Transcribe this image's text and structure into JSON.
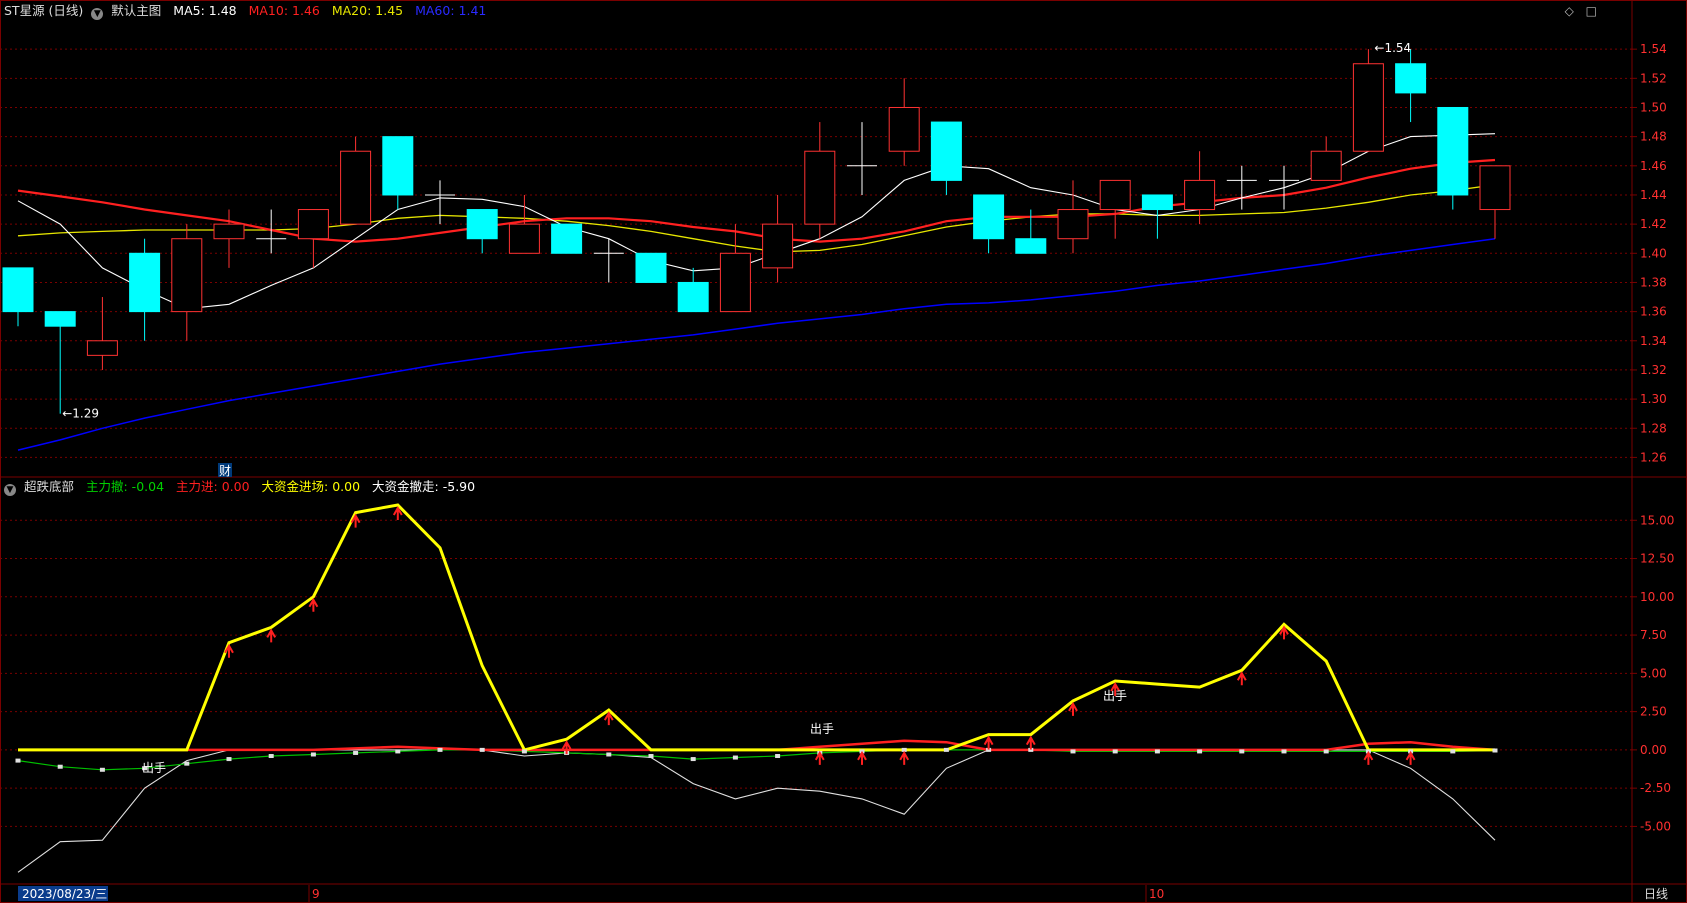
{
  "main_legend": {
    "title": "ST星源 (日线)",
    "template": "默认主图",
    "ma5": "MA5: 1.48",
    "ma10": "MA10: 1.46",
    "ma20": "MA20: 1.45",
    "ma60": "MA60: 1.41"
  },
  "sub_legend": {
    "title": "超跌底部",
    "zlc": "主力撤: -0.04",
    "zlj": "主力进: 0.00",
    "dzjjc": "大资金进场: 0.00",
    "dzjcz": "大资金撤走: -5.90"
  },
  "icons": {
    "diamond": "◇",
    "square": "□"
  },
  "annotations": {
    "low": "←1.29",
    "high": "←1.54",
    "cai": "财",
    "chushou": "出手"
  },
  "xaxis": {
    "date": "2023/08/23/三",
    "m9": "9",
    "m10": "10",
    "period": "日线"
  },
  "colors": {
    "up": "#ff3232",
    "down": "#00ffff",
    "ma5": "#ffffff",
    "ma10": "#ff2020",
    "ma20": "#e6e600",
    "ma60": "#0000ff",
    "yellow_line": "#ffff00",
    "green_line": "#00c000",
    "grid": "#7a0000"
  },
  "chart_data": [
    {
      "type": "candlestick",
      "title": "ST星源 (日线)",
      "ylim": [
        1.25,
        1.56
      ],
      "yticks": [
        1.26,
        1.28,
        1.3,
        1.32,
        1.34,
        1.36,
        1.38,
        1.4,
        1.42,
        1.44,
        1.46,
        1.48,
        1.5,
        1.52,
        1.54
      ],
      "candles": [
        {
          "o": 1.39,
          "h": 1.39,
          "l": 1.35,
          "c": 1.36
        },
        {
          "o": 1.36,
          "h": 1.36,
          "l": 1.29,
          "c": 1.35
        },
        {
          "o": 1.33,
          "h": 1.37,
          "l": 1.32,
          "c": 1.34
        },
        {
          "o": 1.4,
          "h": 1.41,
          "l": 1.34,
          "c": 1.36
        },
        {
          "o": 1.36,
          "h": 1.42,
          "l": 1.34,
          "c": 1.41
        },
        {
          "o": 1.41,
          "h": 1.43,
          "l": 1.39,
          "c": 1.42
        },
        {
          "o": 1.41,
          "h": 1.43,
          "l": 1.4,
          "c": 1.41
        },
        {
          "o": 1.41,
          "h": 1.43,
          "l": 1.39,
          "c": 1.43
        },
        {
          "o": 1.42,
          "h": 1.48,
          "l": 1.42,
          "c": 1.47
        },
        {
          "o": 1.48,
          "h": 1.48,
          "l": 1.43,
          "c": 1.44
        },
        {
          "o": 1.44,
          "h": 1.45,
          "l": 1.42,
          "c": 1.44
        },
        {
          "o": 1.43,
          "h": 1.43,
          "l": 1.4,
          "c": 1.41
        },
        {
          "o": 1.4,
          "h": 1.44,
          "l": 1.4,
          "c": 1.42
        },
        {
          "o": 1.42,
          "h": 1.42,
          "l": 1.4,
          "c": 1.4
        },
        {
          "o": 1.4,
          "h": 1.41,
          "l": 1.38,
          "c": 1.4
        },
        {
          "o": 1.4,
          "h": 1.4,
          "l": 1.38,
          "c": 1.38
        },
        {
          "o": 1.38,
          "h": 1.39,
          "l": 1.36,
          "c": 1.36
        },
        {
          "o": 1.36,
          "h": 1.42,
          "l": 1.36,
          "c": 1.4
        },
        {
          "o": 1.39,
          "h": 1.44,
          "l": 1.38,
          "c": 1.42
        },
        {
          "o": 1.42,
          "h": 1.49,
          "l": 1.41,
          "c": 1.47
        },
        {
          "o": 1.46,
          "h": 1.49,
          "l": 1.44,
          "c": 1.46
        },
        {
          "o": 1.47,
          "h": 1.52,
          "l": 1.46,
          "c": 1.5
        },
        {
          "o": 1.49,
          "h": 1.49,
          "l": 1.44,
          "c": 1.45
        },
        {
          "o": 1.44,
          "h": 1.44,
          "l": 1.4,
          "c": 1.41
        },
        {
          "o": 1.41,
          "h": 1.43,
          "l": 1.4,
          "c": 1.4
        },
        {
          "o": 1.41,
          "h": 1.45,
          "l": 1.4,
          "c": 1.43
        },
        {
          "o": 1.43,
          "h": 1.45,
          "l": 1.41,
          "c": 1.45
        },
        {
          "o": 1.44,
          "h": 1.44,
          "l": 1.41,
          "c": 1.43
        },
        {
          "o": 1.43,
          "h": 1.47,
          "l": 1.42,
          "c": 1.45
        },
        {
          "o": 1.45,
          "h": 1.46,
          "l": 1.43,
          "c": 1.45
        },
        {
          "o": 1.45,
          "h": 1.46,
          "l": 1.43,
          "c": 1.45
        },
        {
          "o": 1.45,
          "h": 1.48,
          "l": 1.45,
          "c": 1.47
        },
        {
          "o": 1.47,
          "h": 1.54,
          "l": 1.47,
          "c": 1.53
        },
        {
          "o": 1.53,
          "h": 1.54,
          "l": 1.49,
          "c": 1.51
        },
        {
          "o": 1.5,
          "h": 1.5,
          "l": 1.43,
          "c": 1.44
        },
        {
          "o": 1.43,
          "h": 1.46,
          "l": 1.41,
          "c": 1.46
        }
      ],
      "ma5": [
        1.436,
        1.42,
        1.39,
        1.375,
        1.362,
        1.365,
        1.378,
        1.39,
        1.41,
        1.43,
        1.438,
        1.437,
        1.432,
        1.418,
        1.41,
        1.395,
        1.388,
        1.39,
        1.4,
        1.41,
        1.425,
        1.45,
        1.46,
        1.458,
        1.445,
        1.44,
        1.43,
        1.426,
        1.43,
        1.438,
        1.445,
        1.455,
        1.47,
        1.48,
        1.481,
        1.482
      ],
      "ma10": [
        1.443,
        1.439,
        1.435,
        1.43,
        1.426,
        1.422,
        1.416,
        1.41,
        1.408,
        1.41,
        1.414,
        1.418,
        1.422,
        1.424,
        1.424,
        1.422,
        1.418,
        1.415,
        1.41,
        1.408,
        1.41,
        1.415,
        1.422,
        1.425,
        1.425,
        1.425,
        1.427,
        1.432,
        1.435,
        1.438,
        1.44,
        1.445,
        1.452,
        1.458,
        1.462,
        1.464
      ],
      "ma20": [
        1.412,
        1.414,
        1.415,
        1.416,
        1.416,
        1.416,
        1.416,
        1.417,
        1.42,
        1.424,
        1.426,
        1.425,
        1.424,
        1.422,
        1.419,
        1.415,
        1.41,
        1.405,
        1.401,
        1.402,
        1.406,
        1.412,
        1.418,
        1.422,
        1.425,
        1.427,
        1.427,
        1.426,
        1.426,
        1.427,
        1.428,
        1.431,
        1.435,
        1.44,
        1.443,
        1.447
      ],
      "ma60": [
        1.265,
        1.272,
        1.28,
        1.287,
        1.293,
        1.299,
        1.304,
        1.309,
        1.314,
        1.319,
        1.324,
        1.328,
        1.332,
        1.335,
        1.338,
        1.341,
        1.344,
        1.348,
        1.352,
        1.355,
        1.358,
        1.362,
        1.365,
        1.366,
        1.368,
        1.371,
        1.374,
        1.378,
        1.381,
        1.385,
        1.389,
        1.393,
        1.398,
        1.402,
        1.406,
        1.41
      ],
      "annotations": [
        "←1.29",
        "←1.54",
        "财"
      ]
    },
    {
      "type": "line",
      "title": "超跌底部",
      "ylim": [
        -8.5,
        17.5
      ],
      "yticks": [
        -5.0,
        -2.5,
        0.0,
        2.5,
        5.0,
        7.5,
        10.0,
        12.5,
        15.0
      ],
      "series": [
        {
          "name": "大资金进场",
          "values": [
            0,
            0,
            0,
            0,
            0,
            7.0,
            8.0,
            10.0,
            15.5,
            16.0,
            13.2,
            5.5,
            0,
            0.7,
            2.6,
            0,
            0,
            0,
            0,
            0,
            0,
            0,
            0,
            1.0,
            1.0,
            3.2,
            4.5,
            4.3,
            4.1,
            5.2,
            8.2,
            5.8,
            0,
            0,
            0,
            0
          ]
        },
        {
          "name": "大资金撤走",
          "values": [
            -8.0,
            -6.0,
            -5.9,
            -2.5,
            -0.7,
            0,
            0,
            0,
            0,
            0,
            0,
            0,
            -0.4,
            -0.2,
            -0.3,
            -0.5,
            -2.2,
            -3.2,
            -2.5,
            -2.7,
            -3.2,
            -4.2,
            -1.2,
            0,
            0,
            0,
            0,
            0,
            0,
            0,
            0,
            0,
            0,
            -1.2,
            -3.2,
            -5.9
          ]
        },
        {
          "name": "主力撤",
          "values": [
            -0.7,
            -1.1,
            -1.3,
            -1.2,
            -0.9,
            -0.6,
            -0.4,
            -0.3,
            -0.2,
            -0.1,
            0,
            0,
            -0.1,
            -0.2,
            -0.3,
            -0.4,
            -0.6,
            -0.5,
            -0.4,
            -0.2,
            -0.1,
            0,
            0,
            0,
            0,
            -0.1,
            -0.1,
            -0.1,
            -0.1,
            -0.1,
            -0.1,
            -0.1,
            -0.1,
            -0.1,
            -0.1,
            -0.04
          ]
        },
        {
          "name": "主力进",
          "values": [
            0,
            0,
            0,
            0,
            0,
            0,
            0,
            0,
            0.1,
            0.2,
            0.1,
            0,
            0,
            0,
            0,
            0,
            0,
            0,
            0,
            0.2,
            0.4,
            0.6,
            0.5,
            0,
            0,
            0,
            0,
            0,
            0,
            0,
            0,
            0,
            0.4,
            0.5,
            0.2,
            0
          ]
        }
      ],
      "arrow_indices": [
        5,
        6,
        7,
        8,
        9,
        13,
        14,
        19,
        20,
        21,
        23,
        24,
        25,
        26,
        29,
        30,
        32,
        33
      ],
      "annotations": [
        "出手",
        "出手",
        "出手"
      ]
    }
  ]
}
